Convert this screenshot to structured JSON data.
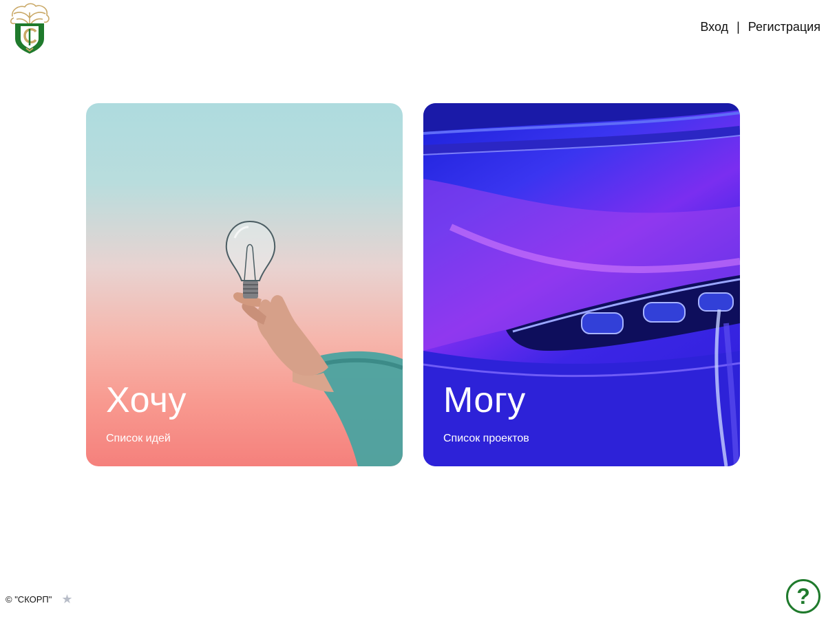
{
  "header": {
    "logo_icon": "shield-tree-logo",
    "login_label": "Вход",
    "separator": "|",
    "register_label": "Регистрация"
  },
  "cards": [
    {
      "title": "Хочу",
      "subtitle": "Список идей",
      "image": "hand-holding-lightbulb"
    },
    {
      "title": "Могу",
      "subtitle": "Список проектов",
      "image": "purple-car-headlight"
    }
  ],
  "footer": {
    "copyright": "© \"СКОРП\"",
    "star_icon": "star-icon"
  },
  "help": {
    "icon": "question-icon",
    "label": "?"
  },
  "colors": {
    "accent_green": "#1f7a2c",
    "logo_gold": "#c9a866",
    "card_can_blue": "#2a1fd6",
    "card_want_coral": "#f5807c"
  }
}
